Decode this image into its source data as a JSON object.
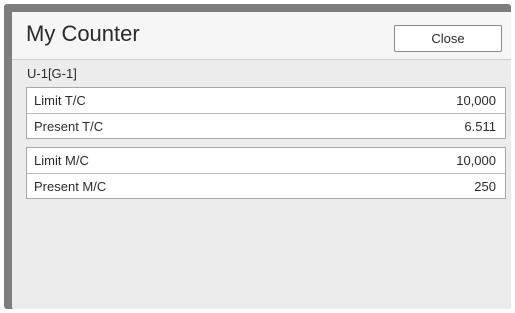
{
  "dialog": {
    "title": "My Counter",
    "close_label": "Close",
    "group_label": "U-1[G-1]"
  },
  "counters": {
    "tc": [
      {
        "label": "Limit T/C",
        "value": "10,000"
      },
      {
        "label": "Present T/C",
        "value": "6.511"
      }
    ],
    "mc": [
      {
        "label": "Limit M/C",
        "value": "10,000"
      },
      {
        "label": "Present M/C",
        "value": "250"
      }
    ]
  },
  "colors": {
    "frame": "#7d7d7d",
    "panel_background": "#ececec",
    "header_background": "#f6f6f6",
    "row_background": "#ffffff",
    "text": "#2b2b2b"
  }
}
